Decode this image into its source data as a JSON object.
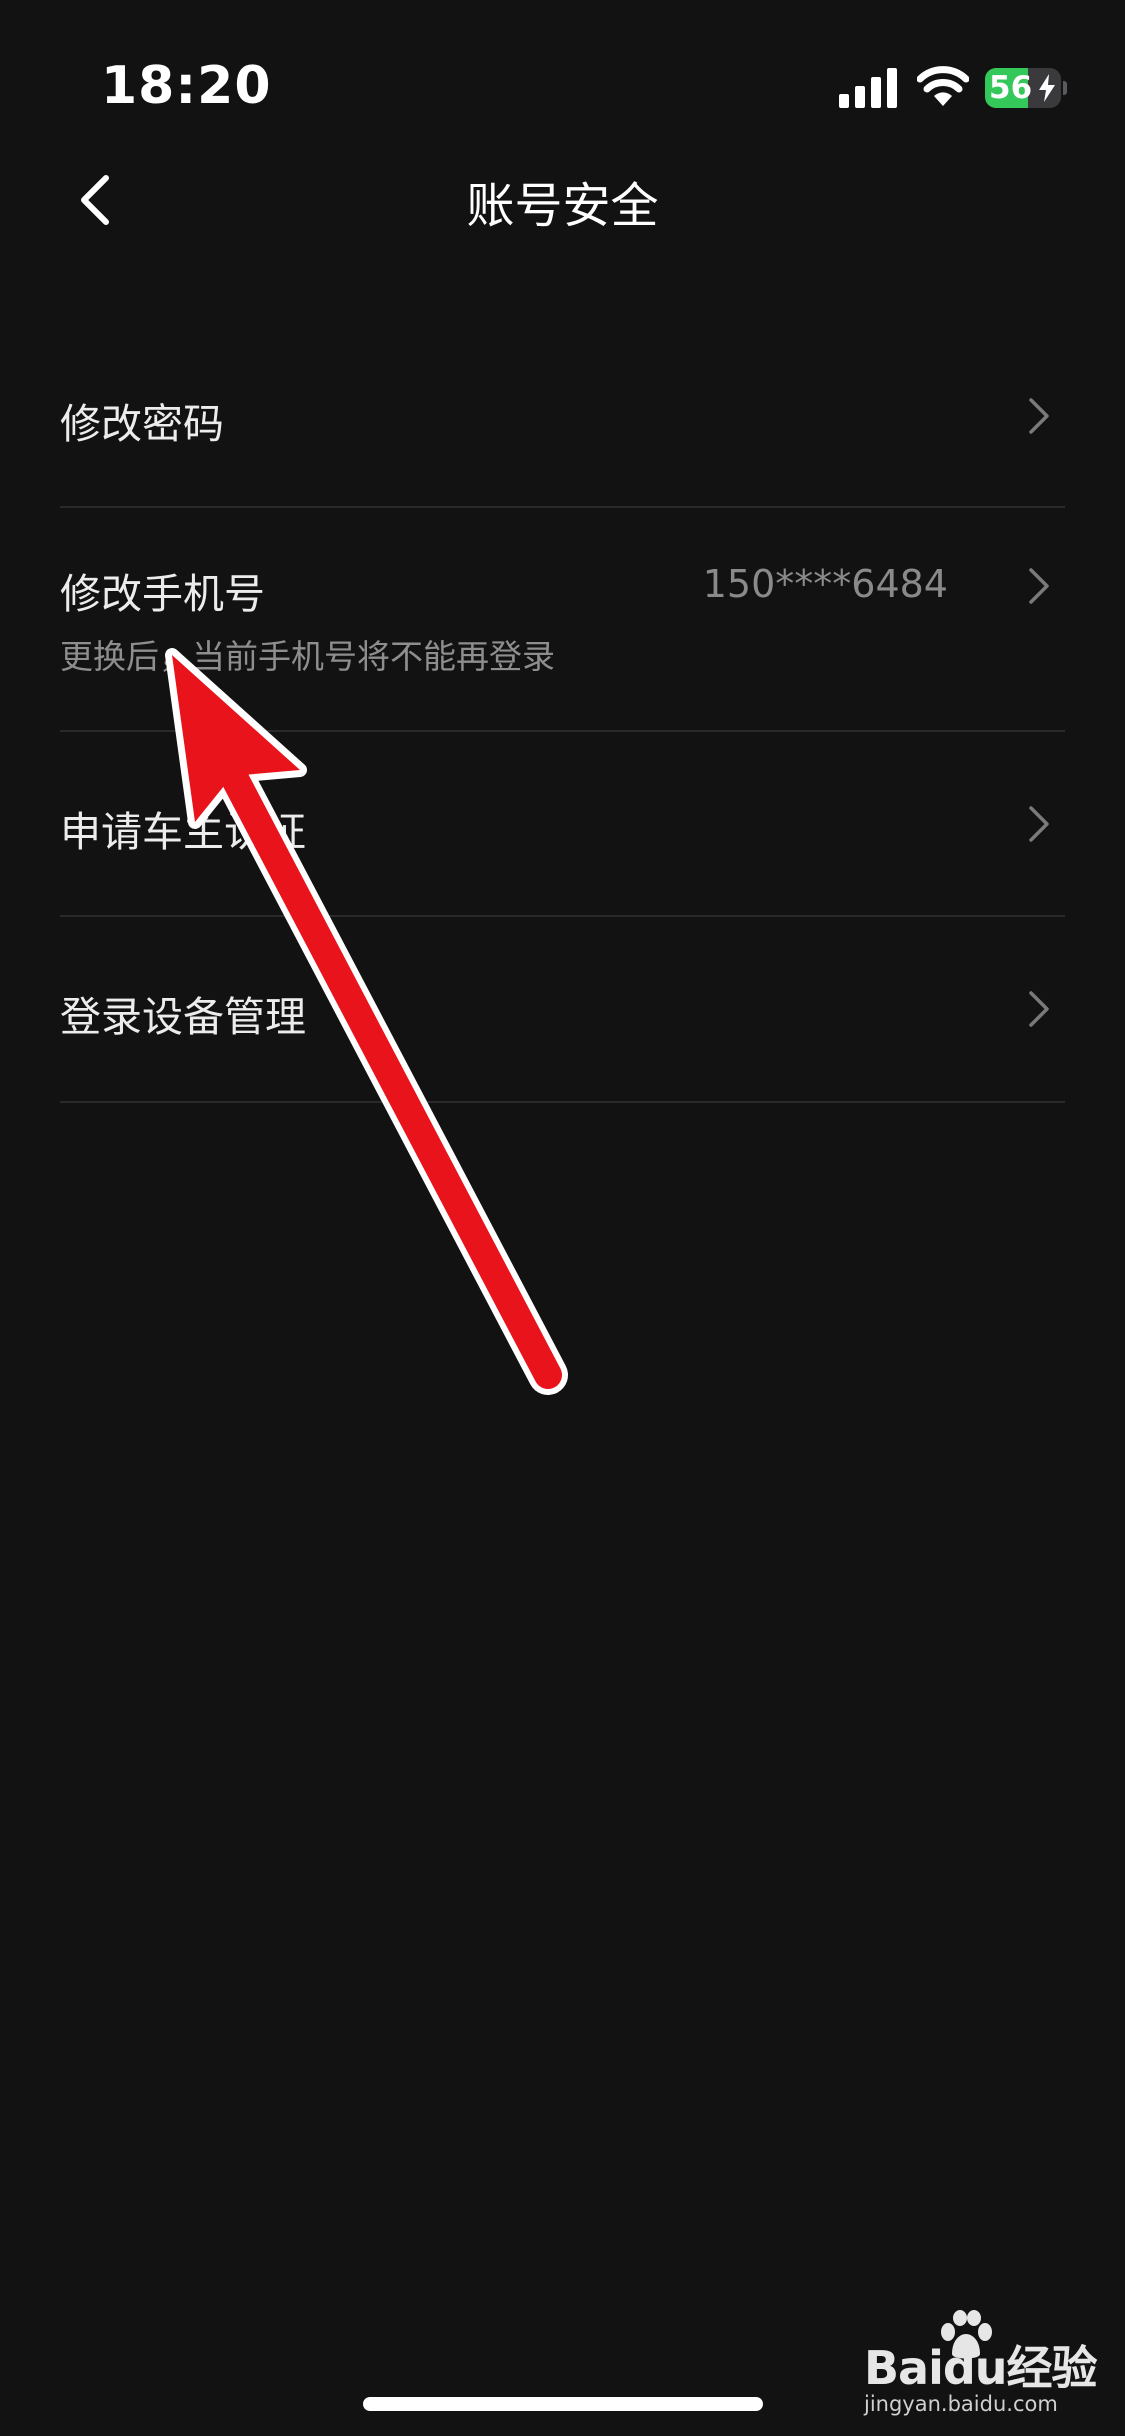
{
  "status_bar": {
    "time": "18:20",
    "battery_percent": "56",
    "battery_level": 0.56,
    "signal_icon": "signal-bars-icon",
    "wifi_icon": "wifi-icon",
    "charging_icon": "bolt-icon"
  },
  "nav": {
    "back_icon": "chevron-left-icon",
    "title": "账号安全"
  },
  "list": {
    "items": [
      {
        "label": "修改密码",
        "value": "",
        "subtitle": "",
        "icon": "chevron-right-icon"
      },
      {
        "label": "修改手机号",
        "value": "150****6484",
        "subtitle": "更换后，当前手机号将不能再登录",
        "icon": "chevron-right-icon"
      },
      {
        "label": "申请车主认证",
        "value": "",
        "subtitle": "",
        "icon": "chevron-right-icon"
      },
      {
        "label": "登录设备管理",
        "value": "",
        "subtitle": "",
        "icon": "chevron-right-icon"
      }
    ]
  },
  "annotation": {
    "icon": "red-arrow-annotation",
    "color": "#e8131b"
  },
  "watermark": {
    "brand": "Baidu经验",
    "url": "jingyan.baidu.com",
    "icon": "baidu-paw-icon"
  },
  "colors": {
    "background": "#121212",
    "text_primary": "#ececec",
    "text_secondary": "#8e8e8e",
    "divider": "#2a2a2a",
    "battery_green": "#34c759",
    "arrow_red": "#e8131b"
  }
}
